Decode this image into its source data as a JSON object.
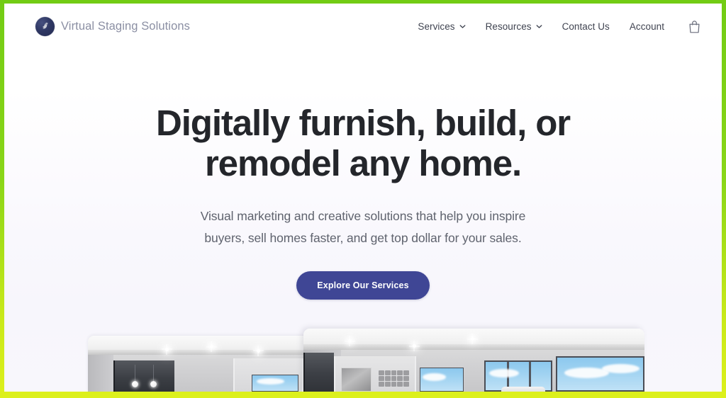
{
  "site": {
    "brand_name": "Virtual Staging Solutions",
    "logo_icon": "dove-circle-logo-icon"
  },
  "nav": {
    "items": [
      {
        "label": "Services",
        "has_dropdown": true,
        "icon": "chevron-down-icon"
      },
      {
        "label": "Resources",
        "has_dropdown": true,
        "icon": "chevron-down-icon"
      },
      {
        "label": "Contact Us",
        "has_dropdown": false,
        "icon": ""
      },
      {
        "label": "Account",
        "has_dropdown": false,
        "icon": ""
      }
    ],
    "cart_icon": "shopping-bag-icon"
  },
  "hero": {
    "heading_line1": "Digitally furnish, build, or",
    "heading_line2": "remodel any home.",
    "subheading_line1": "Visual marketing and creative solutions that help you inspire",
    "subheading_line2": "buyers, sell homes faster, and get top dollar for your sales.",
    "cta_label": "Explore Our Services"
  },
  "showcase": {
    "back_panel_alt": "staged-interior-living-room-photo",
    "front_panel_alt": "staged-interior-windows-photo"
  },
  "colors": {
    "brand_navy": "#2f3864",
    "cta_indigo": "#3f4695",
    "heading_dark": "#24262b",
    "body_gray": "#5f636e",
    "nav_gray": "#3f4350",
    "brand_text_gray": "#8b8fa3",
    "page_bg": "#f8f7fc",
    "capture_frame_green": "#8ad618"
  }
}
